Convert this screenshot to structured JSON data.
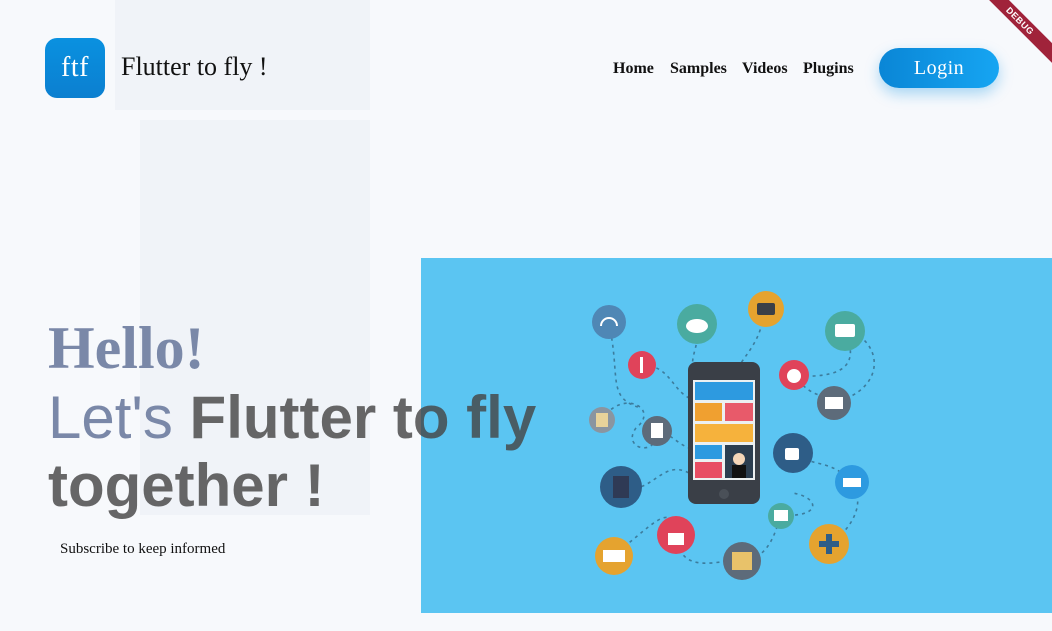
{
  "header": {
    "logo_text": "ftf",
    "brand_title": "Flutter to fly !",
    "nav": [
      "Home",
      "Samples",
      "Videos",
      "Plugins"
    ],
    "login_label": "Login",
    "debug_label": "DEBUG"
  },
  "hero": {
    "hello": "Hello!",
    "line1_light": "Let's ",
    "line1_bold": "Flutter to fly",
    "line2": "together !",
    "subscribe": "Subscribe to keep informed"
  },
  "colors": {
    "accent": "#0a86d6",
    "hero_bg": "#5bc5f2",
    "debug_ribbon": "#a0233a"
  },
  "illustration_icons": [
    "headphones-icon",
    "cloud-icon",
    "video-play-icon",
    "chat-icon",
    "utensils-icon",
    "stopwatch-icon",
    "mail-icon",
    "calculator-icon",
    "document-icon",
    "thumbs-up-icon",
    "book-icon",
    "shopping-basket-icon",
    "photo-icon",
    "gamepad-icon",
    "open-book-icon",
    "lock-icon",
    "map-icon",
    "smartphone-icon"
  ]
}
